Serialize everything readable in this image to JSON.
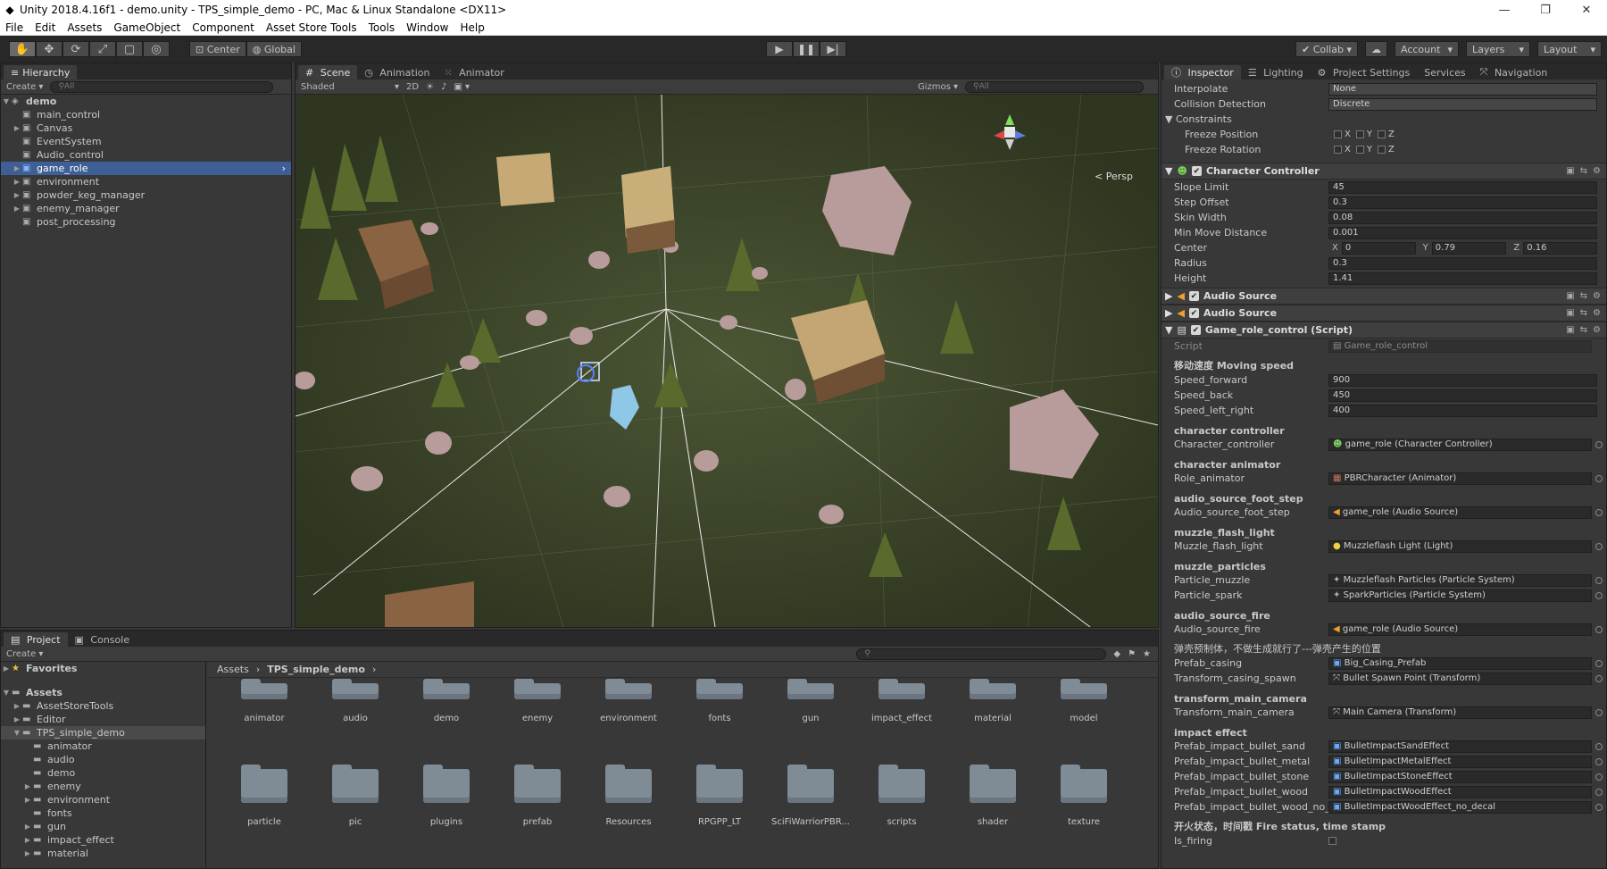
{
  "window": {
    "title": "Unity 2018.4.16f1 - demo.unity - TPS_simple_demo - PC, Mac & Linux Standalone <DX11>"
  },
  "menu": [
    "File",
    "Edit",
    "Assets",
    "GameObject",
    "Component",
    "Asset Store Tools",
    "Tools",
    "Window",
    "Help"
  ],
  "toolbar": {
    "pivot": "Center",
    "space": "Global",
    "collab": "Collab",
    "account": "Account",
    "layers": "Layers",
    "layout": "Layout"
  },
  "hierarchy": {
    "tab": "Hierarchy",
    "create": "Create",
    "search_placeholder": "All",
    "scene": "demo",
    "items": [
      "main_control",
      "Canvas",
      "EventSystem",
      "Audio_control",
      "game_role",
      "environment",
      "powder_keg_manager",
      "enemy_manager",
      "post_processing"
    ],
    "selected_index": 4
  },
  "scene": {
    "tabs": [
      "Scene",
      "Animation",
      "Animator"
    ],
    "shading": "Shaded",
    "mode_2d": "2D",
    "gizmos": "Gizmos",
    "search_placeholder": "All",
    "persp_label": "Persp"
  },
  "project": {
    "tabs": [
      "Project",
      "Console"
    ],
    "create": "Create",
    "favorites": "Favorites",
    "tree": [
      "Assets",
      "AssetStoreTools",
      "Editor",
      "TPS_simple_demo",
      "animator",
      "audio",
      "demo",
      "enemy",
      "environment",
      "fonts",
      "gun",
      "impact_effect",
      "material"
    ],
    "breadcrumb": [
      "Assets",
      "TPS_simple_demo"
    ],
    "folders_row1": [
      "animator",
      "audio",
      "demo",
      "enemy",
      "environment",
      "fonts",
      "gun",
      "impact_effect",
      "material",
      "model"
    ],
    "folders_row2": [
      "particle",
      "pic",
      "plugins",
      "prefab",
      "Resources",
      "RPGPP_LT",
      "SciFiWarriorPBR...",
      "scripts",
      "shader",
      "texture"
    ]
  },
  "inspector": {
    "tabs": [
      "Inspector",
      "Lighting",
      "Project Settings",
      "Services",
      "Navigation"
    ],
    "rigidbody": {
      "interpolate_label": "Interpolate",
      "interpolate": "None",
      "collision_label": "Collision Detection",
      "collision": "Discrete",
      "constraints_label": "Constraints",
      "freeze_position": "Freeze Position",
      "freeze_rotation": "Freeze Rotation",
      "x": "X",
      "y": "Y",
      "z": "Z"
    },
    "char_controller": {
      "title": "Character Controller",
      "slope_limit_label": "Slope Limit",
      "slope_limit": "45",
      "step_offset_label": "Step Offset",
      "step_offset": "0.3",
      "skin_width_label": "Skin Width",
      "skin_width": "0.08",
      "min_move_label": "Min Move Distance",
      "min_move": "0.001",
      "center_label": "Center",
      "center_x": "0",
      "center_y": "0.79",
      "center_z": "0.16",
      "radius_label": "Radius",
      "radius": "0.3",
      "height_label": "Height",
      "height": "1.41"
    },
    "audio_source_1": "Audio Source",
    "audio_source_2": "Audio Source",
    "script": {
      "title": "Game_role_control (Script)",
      "script_label": "Script",
      "script_value": "Game_role_control",
      "moving_header": "移动速度 Moving speed",
      "speed_forward_label": "Speed_forward",
      "speed_forward": "900",
      "speed_back_label": "Speed_back",
      "speed_back": "450",
      "speed_lr_label": "Speed_left_right",
      "speed_lr": "400",
      "cc_header": "character controller",
      "cc_label": "Character_controller",
      "cc_value": "game_role (Character Controller)",
      "anim_header": "character animator",
      "anim_label": "Role_animator",
      "anim_value": "PBRCharacter (Animator)",
      "foot_header": "audio_source_foot_step",
      "foot_label": "Audio_source_foot_step",
      "foot_value": "game_role (Audio Source)",
      "flash_header": "muzzle_flash_light",
      "flash_label": "Muzzle_flash_light",
      "flash_value": "Muzzleflash Light (Light)",
      "particles_header": "muzzle_particles",
      "pmuzzle_label": "Particle_muzzle",
      "pmuzzle_value": "Muzzleflash Particles (Particle System)",
      "pspark_label": "Particle_spark",
      "pspark_value": "SparkParticles (Particle System)",
      "fire_header": "audio_source_fire",
      "fire_label": "Audio_source_fire",
      "fire_value": "game_role (Audio Source)",
      "casing_header": "弹壳预制体，不做生成就行了---弹壳产生的位置",
      "casing_label": "Prefab_casing",
      "casing_value": "Big_Casing_Prefab",
      "spawn_label": "Transform_casing_spawn",
      "spawn_value": "Bullet Spawn Point (Transform)",
      "camera_header": "transform_main_camera",
      "camera_label": "Transform_main_camera",
      "camera_value": "Main Camera (Transform)",
      "impact_header": "impact effect",
      "sand_label": "Prefab_impact_bullet_sand",
      "sand_value": "BulletImpactSandEffect",
      "metal_label": "Prefab_impact_bullet_metal",
      "metal_value": "BulletImpactMetalEffect",
      "stone_label": "Prefab_impact_bullet_stone",
      "stone_value": "BulletImpactStoneEffect",
      "wood_label": "Prefab_impact_bullet_wood",
      "wood_value": "BulletImpactWoodEffect",
      "wood_nd_label": "Prefab_impact_bullet_wood_no_de",
      "wood_nd_value": "BulletImpactWoodEffect_no_decal",
      "status_header": "开火状态，时间戳 Fire status, time stamp",
      "is_firing_label": "Is_firing"
    }
  }
}
